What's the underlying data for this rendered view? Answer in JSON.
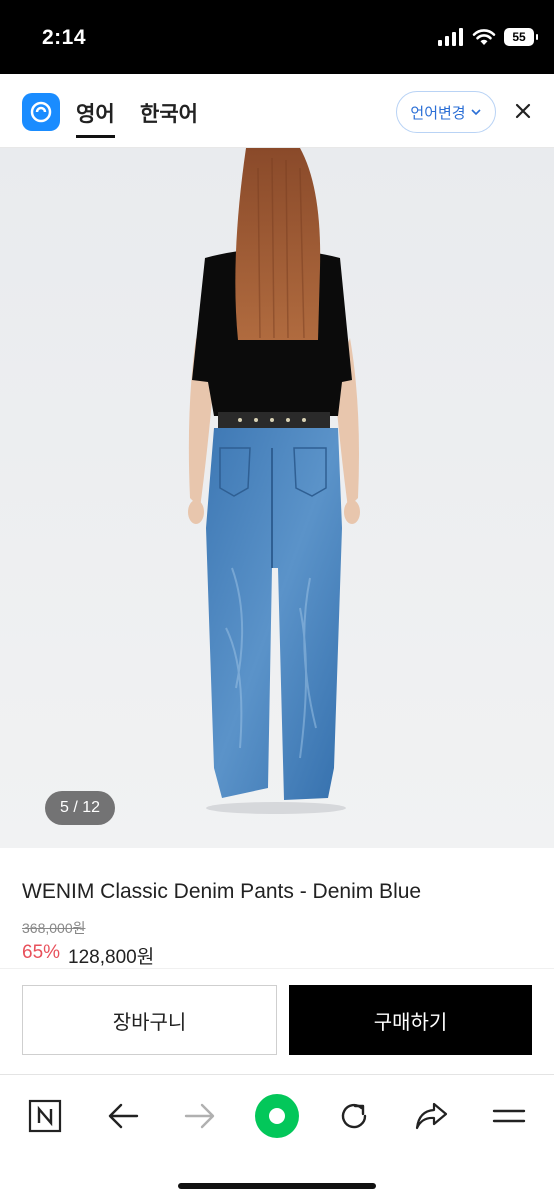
{
  "status": {
    "time": "2:14",
    "battery": "55"
  },
  "translate": {
    "lang_source": "영어",
    "lang_target": "한국어",
    "change_label": "언어변경"
  },
  "gallery": {
    "counter": "5 / 12"
  },
  "product": {
    "name": "WENIM Classic Denim Pants - Denim Blue",
    "original_price": "368,000원",
    "discount": "65%",
    "price": "128,800원"
  },
  "actions": {
    "cart_label": "장바구니",
    "buy_label": "구매하기"
  },
  "toolbar": {
    "icons": [
      "naver-n-icon",
      "back-arrow-icon",
      "forward-arrow-icon",
      "green-dot-icon",
      "refresh-icon",
      "share-icon",
      "menu-icon"
    ],
    "accent_color": "#03c75a"
  },
  "colors": {
    "discount": "#e8505b",
    "papago_blue": "#1a8cff",
    "buy_button": "#000000"
  }
}
